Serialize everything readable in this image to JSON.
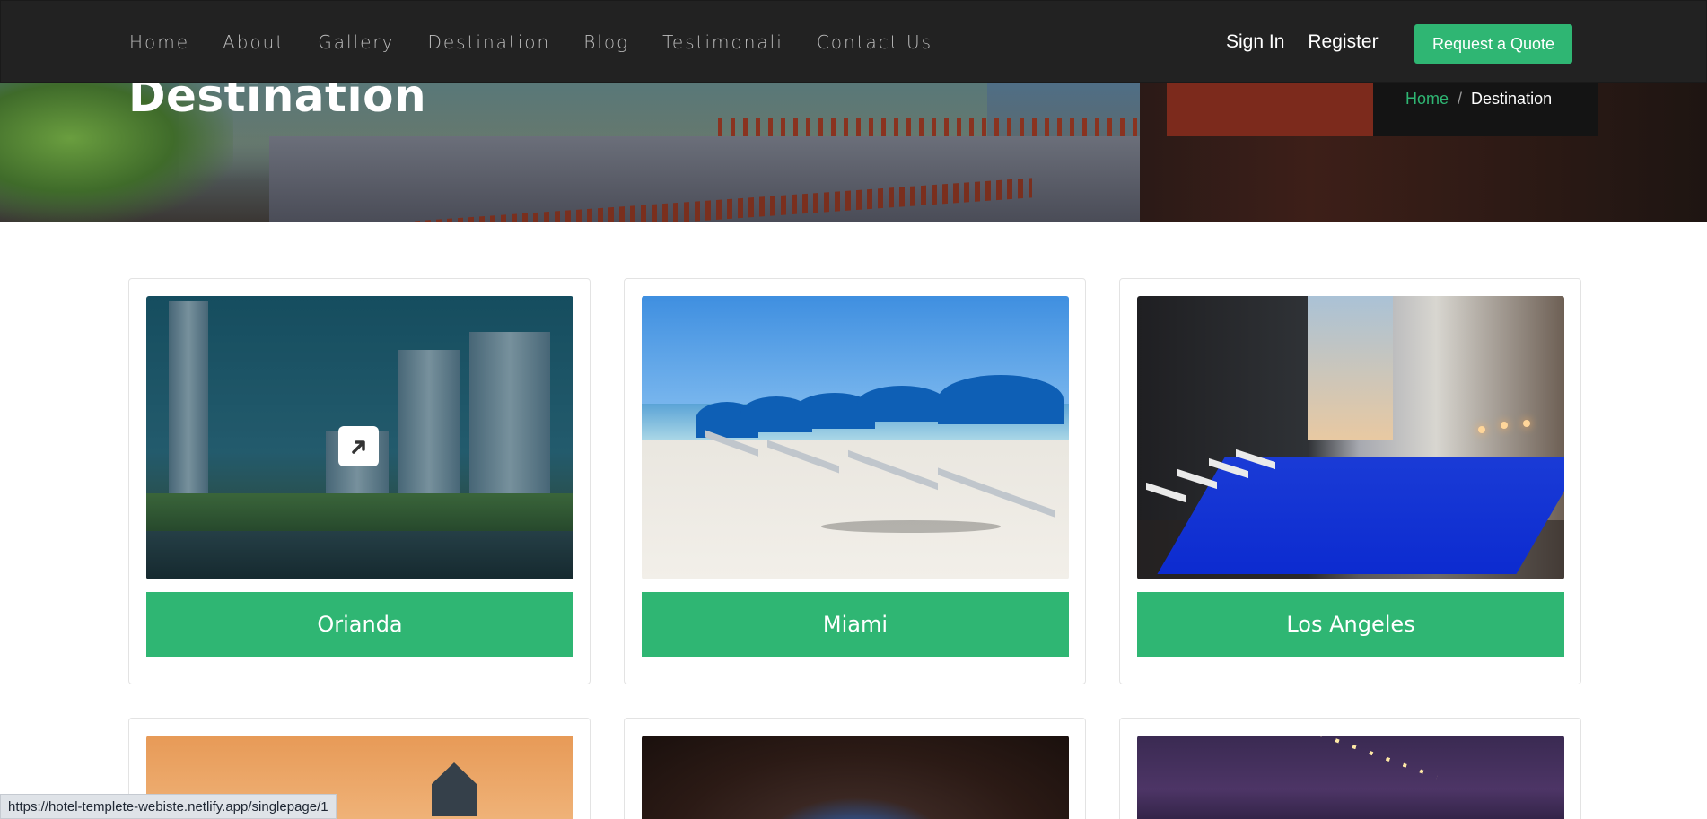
{
  "nav": {
    "links": [
      "Home",
      "About",
      "Gallery",
      "Destination",
      "Blog",
      "Testimonali",
      "Contact Us"
    ],
    "sign_in": "Sign In",
    "register": "Register",
    "quote_button": "Request a Quote"
  },
  "hero": {
    "title": "Destination",
    "breadcrumb": {
      "home": "Home",
      "separator": "/",
      "current": "Destination"
    }
  },
  "destinations": [
    {
      "name": "Orianda"
    },
    {
      "name": "Miami"
    },
    {
      "name": "Los Angeles"
    }
  ],
  "status_bar": {
    "url": "https://hotel-templete-webiste.netlify.app/singlepage/1"
  },
  "colors": {
    "accent": "#2fb673",
    "navbar": "#222222"
  },
  "icons": {
    "card_link": "external-link-arrow-icon"
  }
}
